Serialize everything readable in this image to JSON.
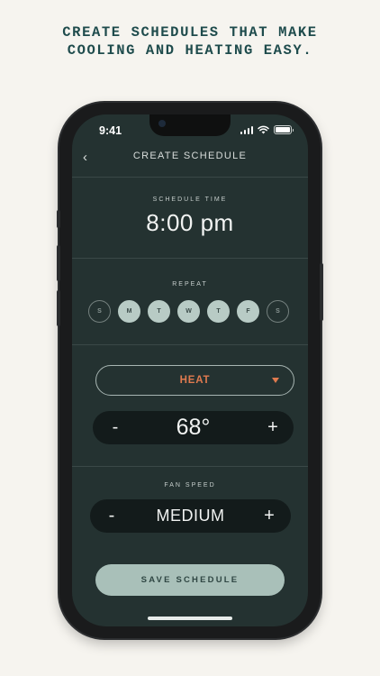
{
  "headline": {
    "line1": "CREATE SCHEDULES THAT MAKE",
    "line2": "COOLING AND HEATING EASY."
  },
  "status_bar": {
    "time": "9:41",
    "icons": [
      "cellular-signal-icon",
      "wifi-icon",
      "battery-icon"
    ]
  },
  "nav": {
    "back_icon": "chevron-left-icon",
    "back_glyph": "‹",
    "title": "CREATE SCHEDULE"
  },
  "schedule_time": {
    "label": "SCHEDULE TIME",
    "value": "8:00 pm"
  },
  "repeat": {
    "label": "REPEAT",
    "days": [
      {
        "letter": "S",
        "selected": false
      },
      {
        "letter": "M",
        "selected": true
      },
      {
        "letter": "T",
        "selected": true
      },
      {
        "letter": "W",
        "selected": true
      },
      {
        "letter": "T",
        "selected": true
      },
      {
        "letter": "F",
        "selected": true
      },
      {
        "letter": "S",
        "selected": false
      }
    ]
  },
  "mode": {
    "value": "HEAT",
    "color": "#e07a4f",
    "dropdown_icon": "caret-down-icon"
  },
  "temperature": {
    "minus": "-",
    "value": "68°",
    "plus": "+"
  },
  "fan_speed": {
    "label": "FAN SPEED",
    "minus": "-",
    "value": "MEDIUM",
    "plus": "+"
  },
  "save_button": {
    "label": "SAVE SCHEDULE"
  },
  "colors": {
    "background": "#f6f4ef",
    "headline": "#1e4b4c",
    "screen": "#243231",
    "accent": "#e07a4f",
    "button": "#a9c0b9",
    "day_selected": "#b8cbc5"
  }
}
